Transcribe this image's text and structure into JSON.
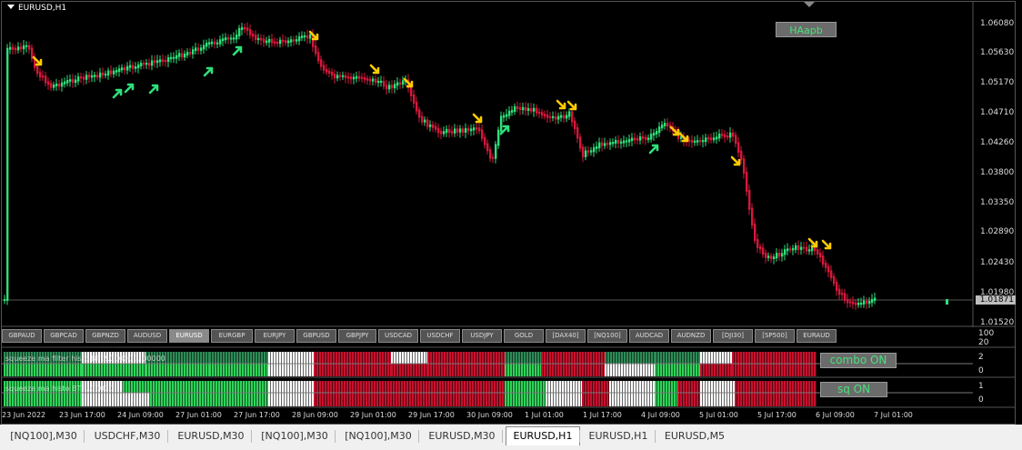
{
  "chart_title": "EURUSD,H1",
  "price_axis": [
    "1.06080",
    "1.05630",
    "1.05170",
    "1.04710",
    "1.04260",
    "1.03800",
    "1.03350",
    "1.02890",
    "1.02430",
    "1.01980",
    "1.01520"
  ],
  "current_price": "1.01871",
  "haapb_button": "HAapb",
  "symbols": [
    "GBPAUD",
    "GBPCAD",
    "GBPNZD",
    "AUDUSD",
    "EURUSD",
    "EURGBP",
    "EURJPY",
    "GBPUSD",
    "GBPJPY",
    "USDCAD",
    "USDCHF",
    "USDJPY",
    "GOLD",
    "[DAX40]",
    "[NQ100]",
    "AUDCAD",
    "AUDNZD",
    "[DJI30]",
    "[SP500]",
    "EURAUD"
  ],
  "active_symbol": "EURUSD",
  "symbol_panel_scale": [
    "100",
    "20"
  ],
  "indicator1": {
    "name": "squeeze ma filter histo BT 2.00000 1.00000",
    "scale": [
      "2",
      "0"
    ],
    "button": "combo ON"
  },
  "indicator2": {
    "name": "squeeze ma histo BT 1.00000",
    "scale": [
      "1",
      "0"
    ],
    "button": "sq ON"
  },
  "time_axis": [
    "23 Jun 2022",
    "23 Jun 17:00",
    "24 Jun 09:00",
    "27 Jun 01:00",
    "27 Jun 17:00",
    "28 Jun 09:00",
    "29 Jun 01:00",
    "29 Jun 17:00",
    "30 Jun 09:00",
    "1 Jul 01:00",
    "1 Jul 17:00",
    "4 Jul 09:00",
    "5 Jul 01:00",
    "5 Jul 17:00",
    "6 Jul 09:00",
    "7 Jul 01:00"
  ],
  "tabs": [
    "[NQ100],M30",
    "USDCHF,M30",
    "EURUSD,M30",
    "[NQ100],M30",
    "[NQ100],M30",
    "EURUSD,M30",
    "EURUSD,H1",
    "EURUSD,H1",
    "EURUSD,M5"
  ],
  "active_tab": "EURUSD,H1",
  "colors": {
    "bull": "#2ee07a",
    "bear": "#d8173b",
    "arrow_up": "#2ee07a",
    "arrow_down": "#ffcc00",
    "histo_red": "#c8102e",
    "histo_green": "#2fd45a",
    "histo_dark": "#2e8b57",
    "histo_white": "#ffffff"
  }
}
